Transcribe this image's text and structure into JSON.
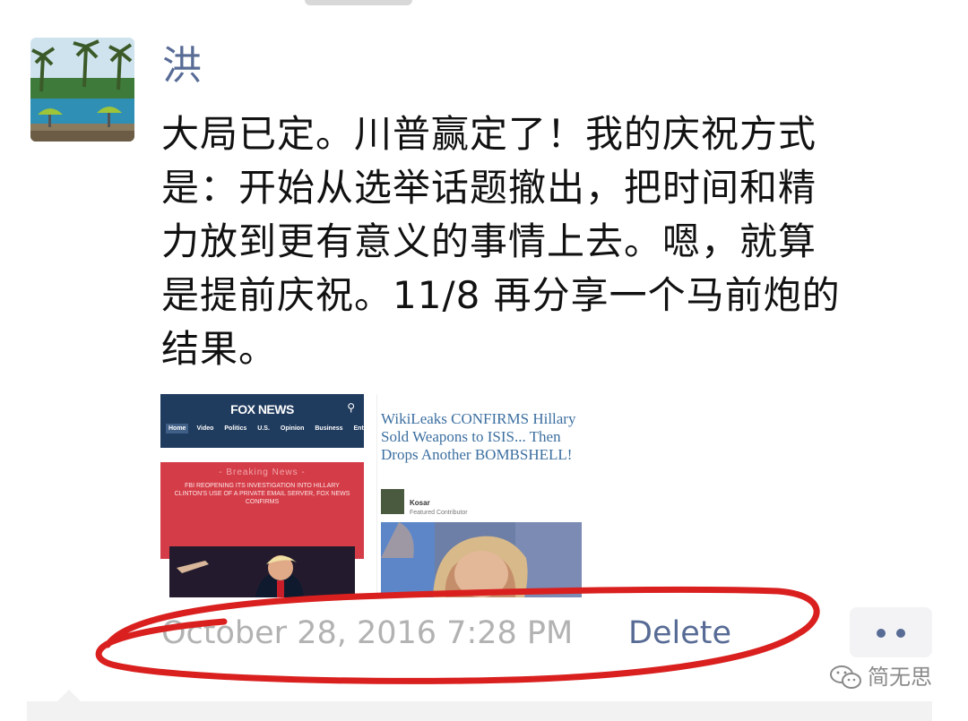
{
  "post": {
    "username": "洪",
    "text_lines": [
      "大局已定。川普赢定了！我的庆祝方式",
      "是：开始从选举话题撤出，把时间和精",
      "力放到更有意义的事情上去。嗯，就算",
      "是提前庆祝。11/8 再分享一个马前炮的",
      "结果。"
    ],
    "timestamp": "October 28, 2016 7:28 PM",
    "delete_label": "Delete"
  },
  "images": {
    "fox": {
      "logo": "FOX NEWS",
      "nav": [
        "Home",
        "Video",
        "Politics",
        "U.S.",
        "Opinion",
        "Business",
        "Entert"
      ],
      "breaking_title": "- Breaking News -",
      "breaking_body": "FBI REOPENING ITS INVESTIGATION INTO HILLARY CLINTON'S USE OF A PRIVATE EMAIL SERVER, FOX NEWS CONFIRMS"
    },
    "wiki": {
      "headline": "WikiLeaks CONFIRMS Hillary Sold Weapons to ISIS... Then Drops Another BOMBSHELL!",
      "author": "Kosar",
      "author_role": "Featured Contributor"
    }
  },
  "watermark": {
    "text": "简无思",
    "icon": "wechat-icon"
  },
  "colors": {
    "link": "#576b95",
    "timestamp": "#b2b2b2",
    "annotation": "#d9201f",
    "text": "#111111"
  }
}
